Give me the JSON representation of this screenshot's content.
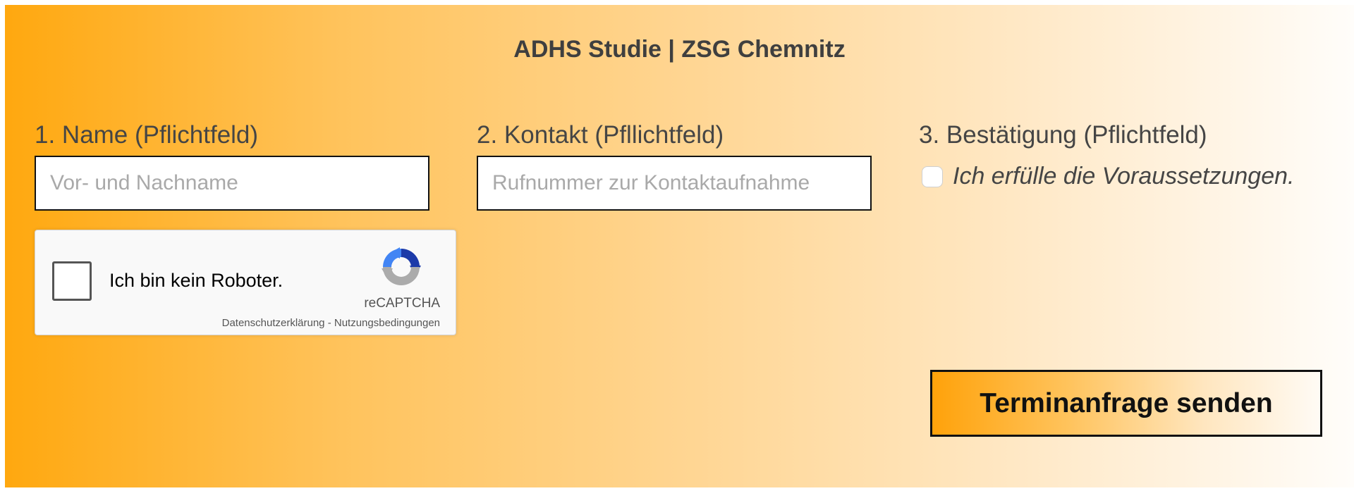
{
  "header": {
    "title": "ADHS Studie | ZSG Chemnitz"
  },
  "form": {
    "name": {
      "label": "1. Name (Pflichtfeld)",
      "placeholder": "Vor- und Nachname",
      "value": ""
    },
    "contact": {
      "label": "2. Kontakt (Pfllichtfeld)",
      "placeholder": "Rufnummer zur Kontaktaufnahme",
      "value": ""
    },
    "confirmation": {
      "label": "3. Bestätigung (Pflichtfeld)",
      "checkbox_text": "Ich erfülle die Voraussetzungen.",
      "checked": false
    },
    "captcha": {
      "label": "Ich bin kein Roboter.",
      "brand": "reCAPTCHA",
      "privacy_link": "Datenschutzerklärung",
      "separator": " - ",
      "terms_link": "Nutzungsbedingungen",
      "logo_icon": "recaptcha-logo-icon"
    },
    "submit_label": "Terminanfrage senden"
  },
  "colors": {
    "accent_orange": "#ffa80f",
    "text_dark": "#454545",
    "border": "#111111",
    "recaptcha_blue": "#1c3aa9",
    "recaptcha_light_blue": "#4285f4",
    "recaptcha_gray": "#ababab"
  }
}
